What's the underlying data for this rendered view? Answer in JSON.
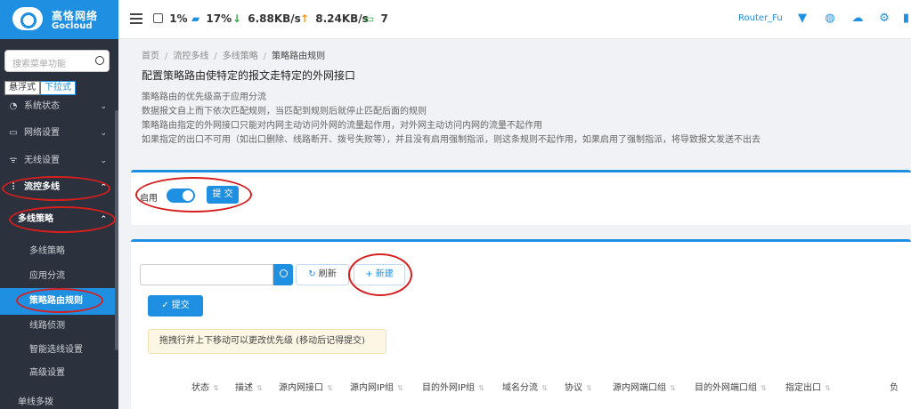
{
  "brand": {
    "name_cn": "高恪网络",
    "name_en": "Gocloud"
  },
  "status": {
    "cpu": "1%",
    "memory": "17%",
    "download": "6.88KB/s",
    "upload": "8.24KB/s",
    "devices": "7"
  },
  "topright": {
    "router_name": "Router_Fu"
  },
  "sidebar": {
    "search_placeholder": "搜索菜单功能",
    "modes": [
      "悬浮式",
      "下拉式"
    ],
    "items": {
      "status": "系统状态",
      "network": "网络设置",
      "wireless": "无线设置",
      "multiwan": "流控多线",
      "policy": "多线策略",
      "sub_policy": "多线策略",
      "app_split": "应用分流",
      "policy_route": "策略路由规则",
      "line_detect": "线路侦测",
      "smart_select": "智能选线设置",
      "advanced": "高级设置",
      "single_multi": "单线多拨"
    }
  },
  "breadcrumb": [
    "首页",
    "流控多线",
    "多线策略",
    "策略路由规则"
  ],
  "page": {
    "title": "配置策略路由使特定的报文走特定的外网接口",
    "desc": [
      "策略路由的优先级高于应用分流",
      "数据报文自上而下依次匹配规则，当匹配到规则后就停止匹配后面的规则",
      "策略路由指定的外网接口只能对内网主动访问外网的流量起作用，对外网主动访问内网的流量不起作用",
      "如果指定的出口不可用（如出口删除、线路断开、拨号失败等），并且没有启用强制指派，则这条规则不起作用，如果启用了强制指派，将导致报文发送不出去"
    ]
  },
  "enable_card": {
    "enable_label": "启用",
    "enabled": true,
    "submit_label": "提 交"
  },
  "rules_card": {
    "refresh_label": "刷新",
    "new_label": "新建",
    "submit_label": "提交",
    "hint": "拖拽行并上下移动可以更改优先级 (移动后记得提交)",
    "columns": [
      "状态",
      "描述",
      "源内网接口",
      "源内网IP组",
      "目的外网IP组",
      "域名分流",
      "协议",
      "源内网端口组",
      "目的外网端口组",
      "指定出口",
      "负"
    ]
  },
  "colors": {
    "accent": "#1e8fe1",
    "sidebar_bg": "#2b323d",
    "annotation_red": "#d71e1e"
  }
}
